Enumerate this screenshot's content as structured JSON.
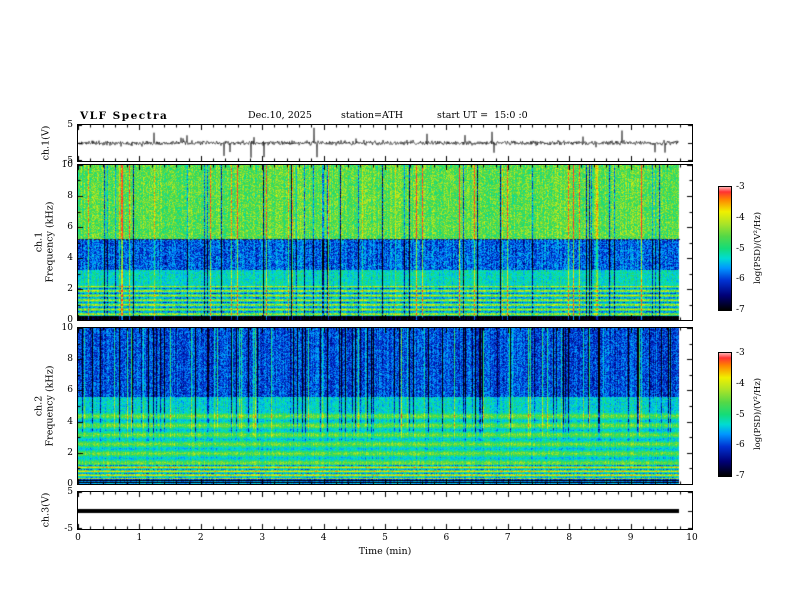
{
  "header": {
    "title": "VLF Spectra",
    "date": "Dec.10, 2025",
    "station": "station=ATH",
    "start_ut": "start UT =  15:0 :0"
  },
  "time_axis": {
    "label": "Time (min)",
    "ticks": [
      0,
      1,
      2,
      3,
      4,
      5,
      6,
      7,
      8,
      9,
      10
    ],
    "range": [
      0,
      10
    ],
    "data_end_min": 9.8
  },
  "panels": {
    "ch1_wave": {
      "ylabel": "ch.1(V)",
      "yticks": [
        5,
        -5
      ],
      "ylim": [
        -5,
        5
      ]
    },
    "ch1_spec": {
      "ylabel_line1": "ch.1",
      "ylabel_line2": "Frequency (kHz)",
      "yticks": [
        0,
        2,
        4,
        6,
        8,
        10
      ],
      "ylim": [
        0,
        10
      ]
    },
    "ch2_spec": {
      "ylabel_line1": "ch.2",
      "ylabel_line2": "Frequency (kHz)",
      "yticks": [
        0,
        2,
        4,
        6,
        8,
        10
      ],
      "ylim": [
        0,
        10
      ]
    },
    "ch3_wave": {
      "ylabel": "ch.3(V)",
      "yticks": [
        5,
        -5
      ],
      "ylim": [
        -5,
        5
      ]
    }
  },
  "colorbar": {
    "label": "log(PSD)/(V²/Hz)",
    "ticks": [
      -3,
      -4,
      -5,
      -6,
      -7
    ],
    "range": [
      -7,
      -3
    ],
    "gradient": [
      {
        "pos": 0,
        "color": "#ffb4b4"
      },
      {
        "pos": 4,
        "color": "#ff3232"
      },
      {
        "pos": 10,
        "color": "#ff8200"
      },
      {
        "pos": 20,
        "color": "#f0f000"
      },
      {
        "pos": 30,
        "color": "#aae428"
      },
      {
        "pos": 40,
        "color": "#55d846"
      },
      {
        "pos": 50,
        "color": "#14dc78"
      },
      {
        "pos": 58,
        "color": "#00dcd2"
      },
      {
        "pos": 66,
        "color": "#0096ff"
      },
      {
        "pos": 76,
        "color": "#0032d2"
      },
      {
        "pos": 88,
        "color": "#000078"
      },
      {
        "pos": 100,
        "color": "#000000"
      }
    ]
  },
  "colormap": [
    [
      -7.0,
      "#000000"
    ],
    [
      -6.6,
      "#000078"
    ],
    [
      -6.2,
      "#0032d2"
    ],
    [
      -5.8,
      "#0096ff"
    ],
    [
      -5.4,
      "#00dcd2"
    ],
    [
      -5.0,
      "#14dc78"
    ],
    [
      -4.6,
      "#55d846"
    ],
    [
      -4.2,
      "#aae428"
    ],
    [
      -3.8,
      "#f0f000"
    ],
    [
      -3.4,
      "#ff8200"
    ],
    [
      -3.0,
      "#ff3232"
    ]
  ],
  "colors": {
    "frame": "#000000",
    "background": "#ffffff",
    "trace": "#000000"
  },
  "chart_data": [
    {
      "type": "line",
      "name": "ch.1 voltage waveform",
      "ylabel": "ch.1(V)",
      "ylim": [
        -5,
        5
      ],
      "x_minutes": [
        0,
        9.8
      ],
      "summary": "dense broadband noise around 0 V (~±1.5 V) with frequent impulsive spikes reaching about ±4.5 V over the full 0–9.8 min record",
      "gen": {
        "seed": 11,
        "noise_sigma": 0.6,
        "spike_prob": 0.05,
        "spike_max": 4.3
      }
    },
    {
      "type": "heatmap",
      "name": "ch.1 VLF spectrogram",
      "x_minutes": [
        0,
        9.8
      ],
      "ylim_kHz": [
        0,
        10
      ],
      "value_range": [
        -7,
        -3
      ],
      "value_units": "log(PSD)/(V²/Hz)",
      "summary": "green/yellow PSD (−4 to −5) above ~5 kHz with red impulsive vertical streaks and dark dropout columns, blue band (~−6) between 3–5 kHz, striped yellow/green horizontal bands below 2 kHz, black band near 0 kHz",
      "seed": 23,
      "dotted_hline": 5.2,
      "bands": [
        {
          "f": [
            0,
            0.25
          ],
          "v": -7.0,
          "noise": 0.15
        },
        {
          "f": [
            0.25,
            2.2
          ],
          "v": -5.0,
          "noise": 0.45,
          "stripes": {
            "period": 0.3,
            "amp": 0.85
          }
        },
        {
          "f": [
            2.2,
            3.2
          ],
          "v": -5.3,
          "noise": 0.4
        },
        {
          "f": [
            3.2,
            5.2
          ],
          "v": -6.0,
          "noise": 0.45
        },
        {
          "f": [
            5.2,
            10
          ],
          "v": -4.6,
          "noise": 0.5
        }
      ],
      "streaks": {
        "dark_prob": 0.05,
        "dark_amp": -1.6,
        "bright_prob": 0.04,
        "bright_amp": 1.3,
        "fmin": 0.4,
        "ramp": 1.0
      }
    },
    {
      "type": "heatmap",
      "name": "ch.2 VLF spectrogram",
      "x_minutes": [
        0,
        9.8
      ],
      "ylim_kHz": [
        0,
        10
      ],
      "value_range": [
        -7,
        -3
      ],
      "value_units": "log(PSD)/(V²/Hz)",
      "summary": "blue PSD (~−6) above ~5.5 kHz with many dark/black vertical dropout columns and occasional green columns, green (~−5) with bright yellow horizontal lines between 0.5–4.5 kHz, strong striped band below 1 kHz, black band near 0 kHz",
      "seed": 41,
      "dotted_hline": null,
      "bands": [
        {
          "f": [
            0,
            0.3
          ],
          "v": -6.8,
          "noise": 0.3,
          "stripes": {
            "period": 0.12,
            "amp": 1.1
          }
        },
        {
          "f": [
            0.3,
            1.2
          ],
          "v": -4.8,
          "noise": 0.4,
          "stripes": {
            "period": 0.25,
            "amp": 1.0
          }
        },
        {
          "f": [
            1.2,
            4.6
          ],
          "v": -5.0,
          "noise": 0.35,
          "stripes": {
            "period": 0.6,
            "amp": 0.5
          }
        },
        {
          "f": [
            4.6,
            5.6
          ],
          "v": -5.4,
          "noise": 0.4
        },
        {
          "f": [
            5.6,
            10
          ],
          "v": -6.1,
          "noise": 0.4
        }
      ],
      "streaks": {
        "dark_prob": 0.12,
        "dark_amp": -1.2,
        "bright_prob": 0.05,
        "bright_amp": 1.0,
        "fmin": 4.0,
        "ramp": 1.5
      }
    },
    {
      "type": "line",
      "name": "ch.3 voltage waveform",
      "ylabel": "ch.3(V)",
      "ylim": [
        -5,
        5
      ],
      "x_minutes": [
        0,
        9.8
      ],
      "values_constant": 0,
      "summary": "flat thick black line at 0 V for the entire record (no signal on channel 3)"
    }
  ]
}
